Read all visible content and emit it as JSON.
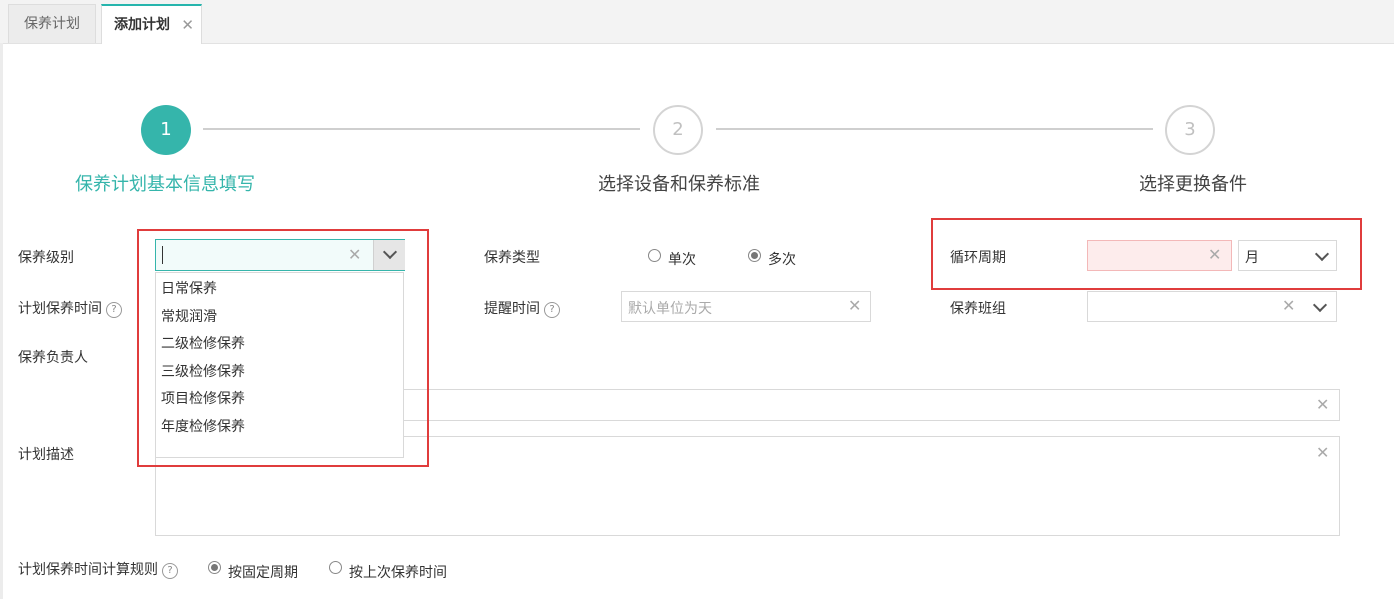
{
  "tabs": [
    {
      "label": "保养计划"
    },
    {
      "label": "添加计划",
      "close": "✕"
    }
  ],
  "steps": [
    {
      "number": "1",
      "label": "保养计划基本信息填写",
      "active": true
    },
    {
      "number": "2",
      "label": "选择设备和保养标准",
      "active": false
    },
    {
      "number": "3",
      "label": "选择更换备件",
      "active": false
    }
  ],
  "form": {
    "level_label": "保养级别",
    "level_value": "",
    "level_options": [
      "日常保养",
      "常规润滑",
      "二级检修保养",
      "三级检修保养",
      "项目检修保养",
      "年度检修保养"
    ],
    "type_label": "保养类型",
    "type_options": [
      {
        "label": "单次",
        "checked": false
      },
      {
        "label": "多次",
        "checked": true
      }
    ],
    "cycle_label": "循环周期",
    "cycle_value": "",
    "cycle_unit": "月",
    "plan_time_label": "计划保养时间",
    "remind_label": "提醒时间",
    "remind_placeholder": "默认单位为天",
    "team_label": "保养班组",
    "owner_label": "保养负责人",
    "desc_label": "计划描述",
    "rule_label": "计划保养时间计算规则",
    "rule_options": [
      {
        "label": "按固定周期",
        "checked": true
      },
      {
        "label": "按上次保养时间",
        "checked": false
      }
    ],
    "help_glyph": "?",
    "clear_glyph": "✕"
  },
  "colors": {
    "accent": "#35b5ab",
    "highlight_box": "#e03c3c",
    "error_input_bg": "#fdecec"
  }
}
